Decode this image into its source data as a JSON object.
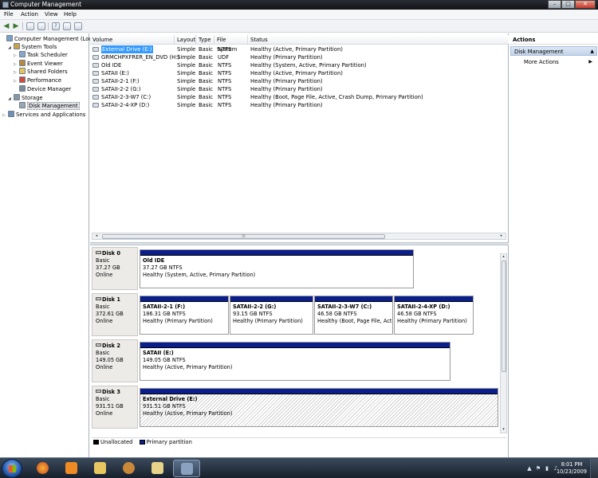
{
  "window": {
    "title": "Computer Management",
    "minimize": "–",
    "maximize": "□",
    "close": "✕"
  },
  "menubar": [
    "File",
    "Action",
    "View",
    "Help"
  ],
  "toolbar": {
    "icons": [
      "back-arrow-icon",
      "forward-arrow-icon",
      "up-folder-icon",
      "show-hide-tree-icon",
      "help-icon",
      "properties-icon",
      "extra-icon"
    ]
  },
  "tree": [
    {
      "label": "Computer Management (Local",
      "expander": "",
      "icon": "computer-icon",
      "color": "#7aa0c8"
    },
    {
      "label": "System Tools",
      "expander": "◢",
      "icon": "tools-icon",
      "color": "#c9a24b"
    },
    {
      "label": "Task Scheduler",
      "expander": "▷",
      "icon": "clock-icon",
      "color": "#8aa7c9"
    },
    {
      "label": "Event Viewer",
      "expander": "▷",
      "icon": "event-viewer-icon",
      "color": "#b88a3e"
    },
    {
      "label": "Shared Folders",
      "expander": "▷",
      "icon": "folder-icon",
      "color": "#e8c25a"
    },
    {
      "label": "Performance",
      "expander": "▷",
      "icon": "performance-icon",
      "color": "#d14b3b"
    },
    {
      "label": "Device Manager",
      "expander": "",
      "icon": "device-manager-icon",
      "color": "#7c8a99"
    },
    {
      "label": "Storage",
      "expander": "◢",
      "icon": "storage-icon",
      "color": "#8a96a4"
    },
    {
      "label": "Disk Management",
      "expander": "",
      "icon": "disk-icon",
      "color": "#9aa5b1"
    },
    {
      "label": "Services and Applications",
      "expander": "▷",
      "icon": "services-icon",
      "color": "#6f8fb5"
    }
  ],
  "volumes": {
    "columns": [
      "Volume",
      "Layout",
      "Type",
      "File System",
      "Status"
    ],
    "rows": [
      [
        "External Drive (E:)",
        "Simple",
        "Basic",
        "NTFS",
        "Healthy (Active, Primary Partition)"
      ],
      [
        "GRMCHPXFRER_EN_DVD (H:)",
        "Simple",
        "Basic",
        "UDF",
        "Healthy (Primary Partition)"
      ],
      [
        "Old IDE",
        "Simple",
        "Basic",
        "NTFS",
        "Healthy (System, Active, Primary Partition)"
      ],
      [
        "SATAII (E:)",
        "Simple",
        "Basic",
        "NTFS",
        "Healthy (Active, Primary Partition)"
      ],
      [
        "SATAII-2-1 (F:)",
        "Simple",
        "Basic",
        "NTFS",
        "Healthy (Primary Partition)"
      ],
      [
        "SATAII-2-2 (G:)",
        "Simple",
        "Basic",
        "NTFS",
        "Healthy (Primary Partition)"
      ],
      [
        "SATAII-2-3-W7 (C:)",
        "Simple",
        "Basic",
        "NTFS",
        "Healthy (Boot, Page File, Active, Crash Dump, Primary Partition)"
      ],
      [
        "SATAII-2-4-XP (D:)",
        "Simple",
        "Basic",
        "NTFS",
        "Healthy (Primary Partition)"
      ]
    ]
  },
  "scroll": {
    "grip": "III",
    "left": "◂",
    "right": "▸",
    "up": "▴",
    "down": "▾"
  },
  "disks": [
    {
      "name": "Disk 0",
      "type": "Basic",
      "size": "37.27 GB",
      "state": "Online",
      "partitions": [
        {
          "name": "Old IDE",
          "size": "37.27 GB NTFS",
          "status": "Healthy (System, Active, Primary Partition)"
        }
      ]
    },
    {
      "name": "Disk 1",
      "type": "Basic",
      "size": "372.61 GB",
      "state": "Online",
      "partitions": [
        {
          "name": "SATAII-2-1  (F:)",
          "size": "186.31 GB NTFS",
          "status": "Healthy (Primary Partition)"
        },
        {
          "name": "SATAII-2-2  (G:)",
          "size": "93.15 GB NTFS",
          "status": "Healthy (Primary Partition)"
        },
        {
          "name": "SATAII-2-3-W7  (C:)",
          "size": "46.58 GB NTFS",
          "status": "Healthy (Boot, Page File, Acti"
        },
        {
          "name": "SATAII-2-4-XP  (D:)",
          "size": "46.58 GB NTFS",
          "status": "Healthy (Primary Partition)"
        }
      ]
    },
    {
      "name": "Disk 2",
      "type": "Basic",
      "size": "149.05 GB",
      "state": "Online",
      "partitions": [
        {
          "name": "SATAII  (E:)",
          "size": "149.05 GB NTFS",
          "status": "Healthy (Active, Primary Partition)"
        }
      ]
    },
    {
      "name": "Disk 3",
      "type": "Basic",
      "size": "931.51 GB",
      "state": "Online",
      "partitions": [
        {
          "name": "External Drive  (E:)",
          "size": "931.51 GB NTFS",
          "status": "Healthy (Active, Primary Partition)"
        }
      ]
    }
  ],
  "legend": [
    {
      "label": "Unallocated",
      "color": "#000000"
    },
    {
      "label": "Primary partition",
      "color": "#0a1e8c"
    }
  ],
  "actions": {
    "title": "Actions",
    "section": "Disk Management",
    "section_caret": "▲",
    "item": "More Actions",
    "item_caret": "▶"
  },
  "taskbar": {
    "apps": [
      {
        "icon": "firefox-icon",
        "color": "#e8751a"
      },
      {
        "icon": "media-player-icon",
        "color": "#f08a24"
      },
      {
        "icon": "explorer-folder-icon",
        "color": "#e9c760"
      },
      {
        "icon": "user-icon",
        "color": "#c9883a"
      },
      {
        "icon": "notepad-icon",
        "color": "#e7d38a"
      },
      {
        "icon": "computer-management-icon",
        "color": "#8aa2c0"
      }
    ],
    "tray": [
      "▲",
      "⚑",
      "▮",
      "♪"
    ],
    "time": "8:01 PM",
    "date": "10/23/2009"
  }
}
